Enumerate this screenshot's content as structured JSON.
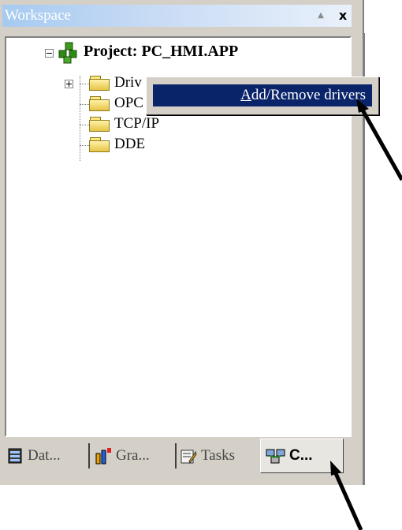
{
  "window": {
    "title": "Workspace",
    "close_symbol": "x",
    "scroll_up_symbol": "▲"
  },
  "tree": {
    "project": {
      "label": "Project: PC_HMI.APP"
    },
    "items": [
      {
        "label": "Driv",
        "expandable": true
      },
      {
        "label": "OPC"
      },
      {
        "label": "TCP/IP"
      },
      {
        "label": "DDE"
      }
    ]
  },
  "context_menu": {
    "item_label": "Add/Remove drivers",
    "mnemonic": "A"
  },
  "tabs": [
    {
      "label": "Dat...",
      "icon": "database-icon"
    },
    {
      "label": "Gra...",
      "icon": "graphics-icon"
    },
    {
      "label": "Tasks",
      "icon": "tasks-icon"
    },
    {
      "label": "C...",
      "icon": "comm-icon",
      "active": true
    }
  ],
  "colors": {
    "menu_highlight": "#0a246a",
    "title_gradient_start": "#a6caf0",
    "panel": "#d4d0c8"
  }
}
